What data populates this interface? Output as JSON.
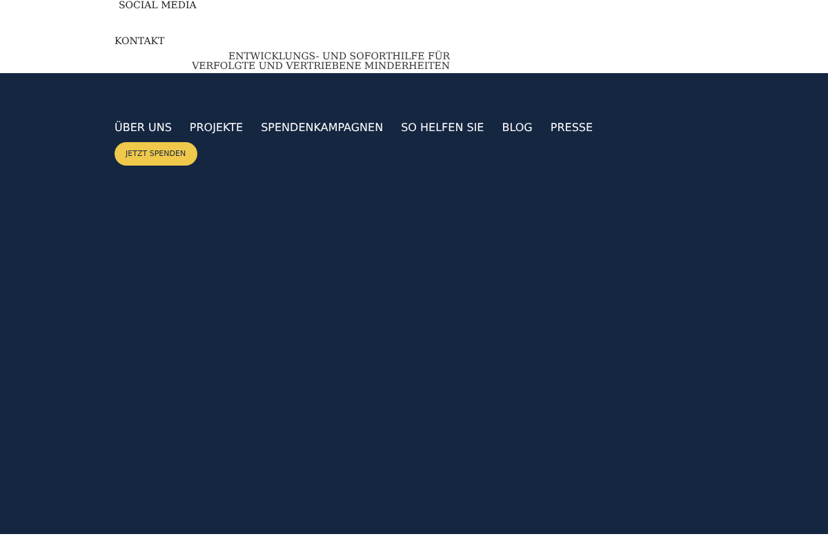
{
  "top_links": [
    "SOCIAL MEDIA",
    "KONTAKT"
  ],
  "tagline": "ENTWICKLUNGS- UND SOFORTHILFE FÜR VERFOLGTE UND VERTRIEBENE MINDERHEITEN",
  "nav": {
    "items": [
      "ÜBER UNS",
      "PROJEKTE",
      "SPENDENKAMPAGNEN",
      "SO HELFEN SIE",
      "BLOG",
      "PRESSE"
    ],
    "cta": "JETZT SPENDEN"
  }
}
